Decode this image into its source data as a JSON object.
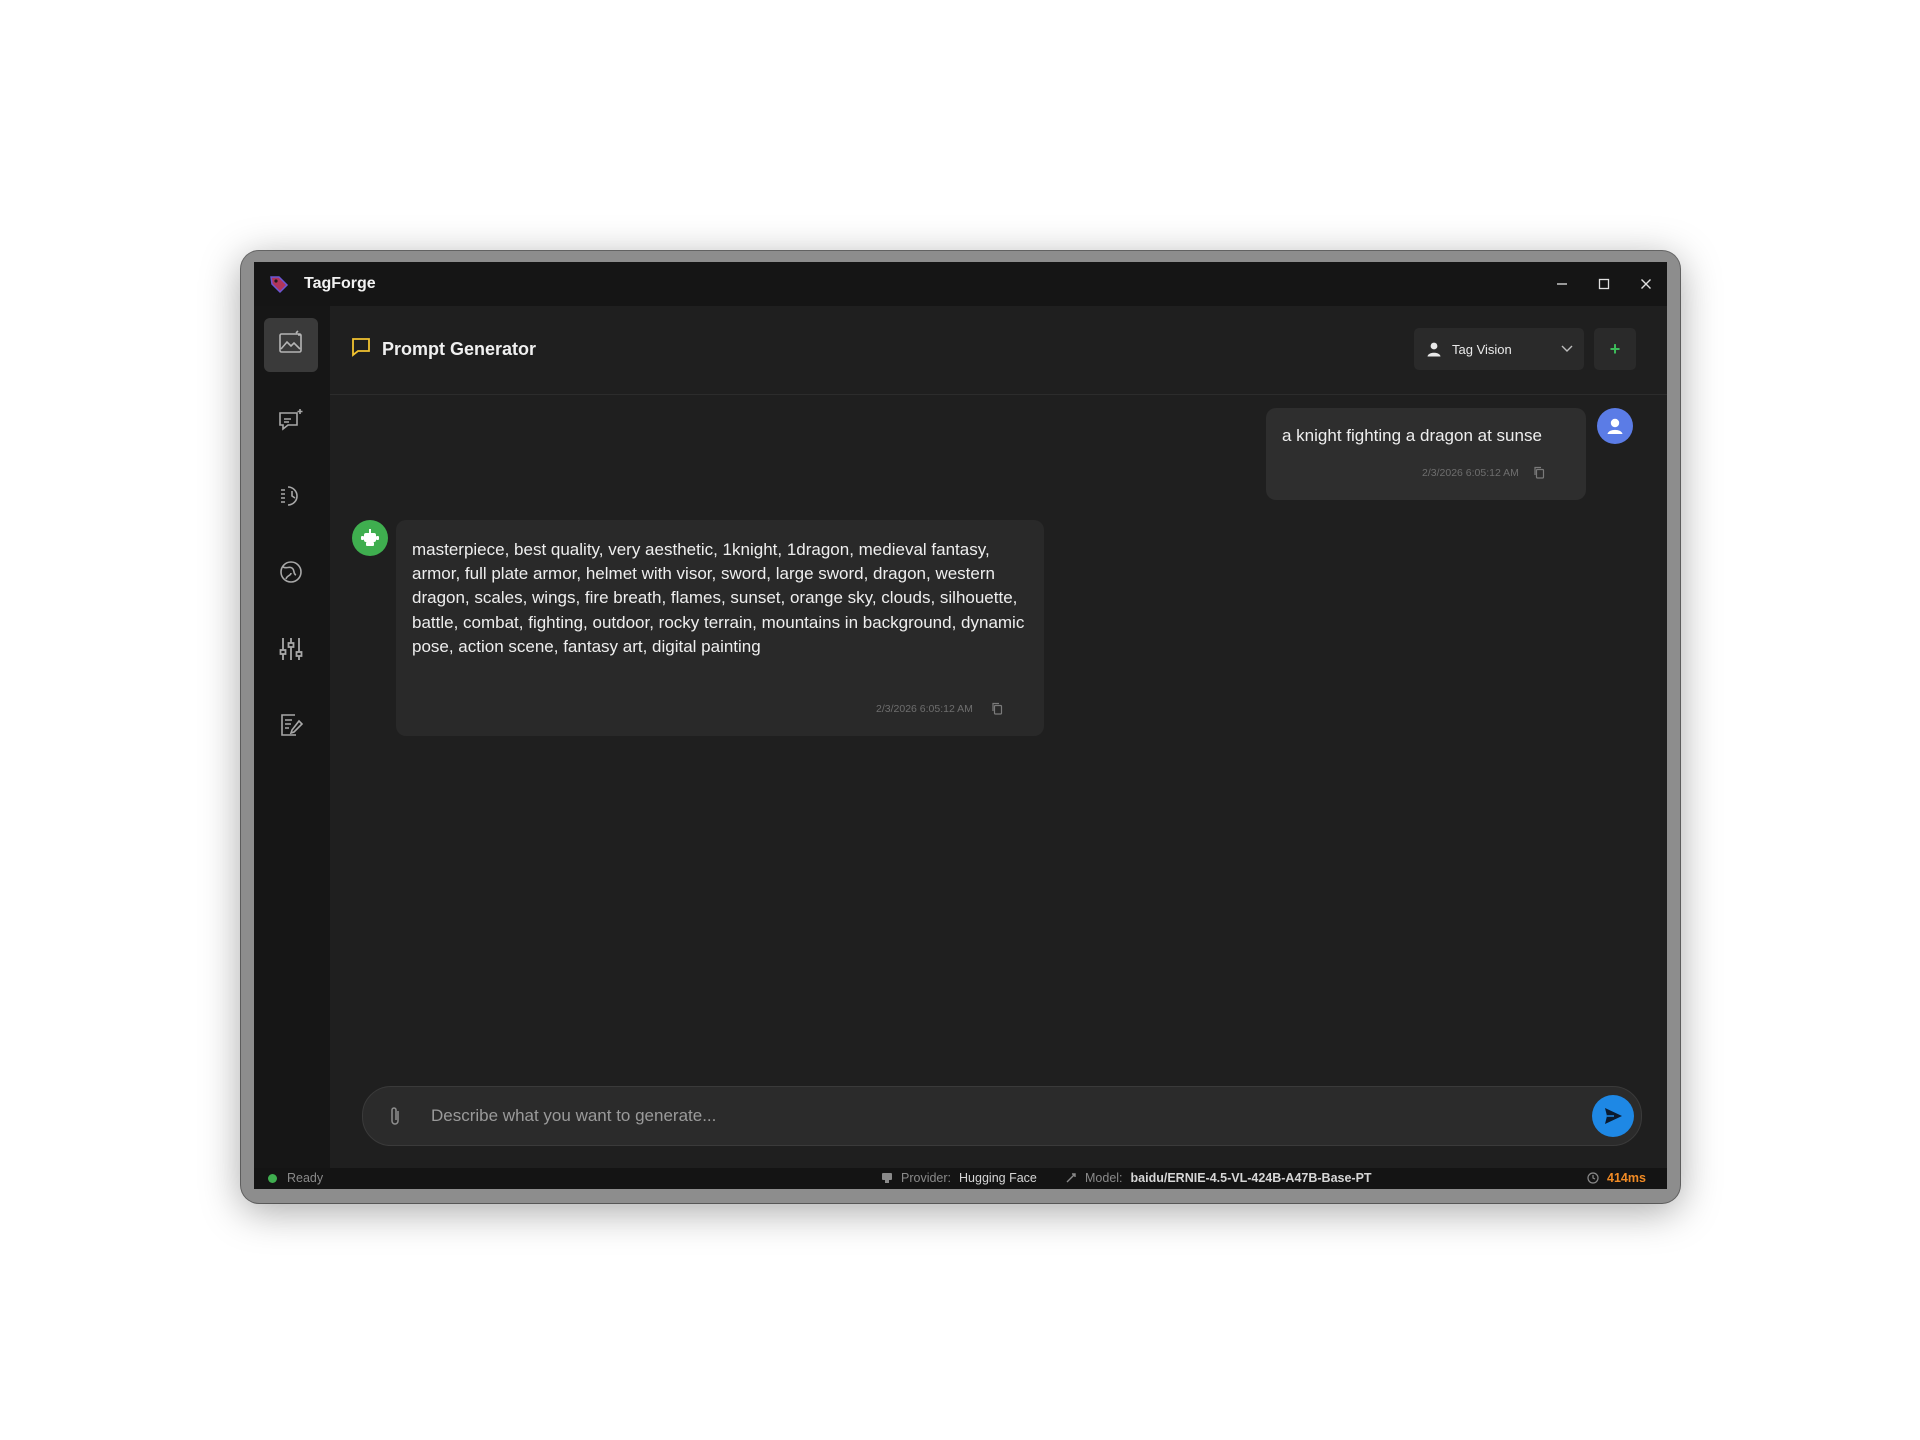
{
  "app": {
    "title": "TagForge"
  },
  "sidebar": {
    "items": [
      {
        "icon": "image-icon",
        "active": true
      },
      {
        "icon": "chat-sparkle-icon",
        "active": false
      },
      {
        "icon": "history-icon",
        "active": false
      },
      {
        "icon": "globe-icon",
        "active": false
      },
      {
        "icon": "sliders-icon",
        "active": false
      },
      {
        "icon": "notes-edit-icon",
        "active": false
      }
    ]
  },
  "header": {
    "title": "Prompt Generator",
    "persona": {
      "label": "Tag Vision"
    },
    "add_label": "+"
  },
  "messages": {
    "user": {
      "text": "a knight fighting a dragon at sunse",
      "timestamp": "2/3/2026 6:05:12 AM"
    },
    "assistant": {
      "text": "masterpiece, best quality, very aesthetic, 1knight, 1dragon, medieval fantasy, armor, full plate armor, helmet with visor, sword, large sword, dragon, western dragon, scales, wings, fire breath, flames, sunset, orange sky, clouds, silhouette, battle, combat, fighting, outdoor, rocky terrain, mountains in background, dynamic pose, action scene, fantasy art, digital painting",
      "timestamp": "2/3/2026 6:05:12 AM"
    }
  },
  "composer": {
    "placeholder": "Describe what you want to generate...",
    "value": ""
  },
  "status": {
    "state": "Ready",
    "provider_label": "Provider:",
    "provider": "Hugging Face",
    "model_label": "Model:",
    "model": "baidu/ERNIE-4.5-VL-424B-A47B-Base-PT",
    "latency": "414ms"
  },
  "colors": {
    "accent": "#1e88e5",
    "user_avatar": "#5b7ce6",
    "bot_avatar": "#3fae4f",
    "status_ready": "#3fae4f",
    "latency": "#f08a24",
    "title_icon": "#f2c230",
    "add": "#3dbb5a"
  }
}
